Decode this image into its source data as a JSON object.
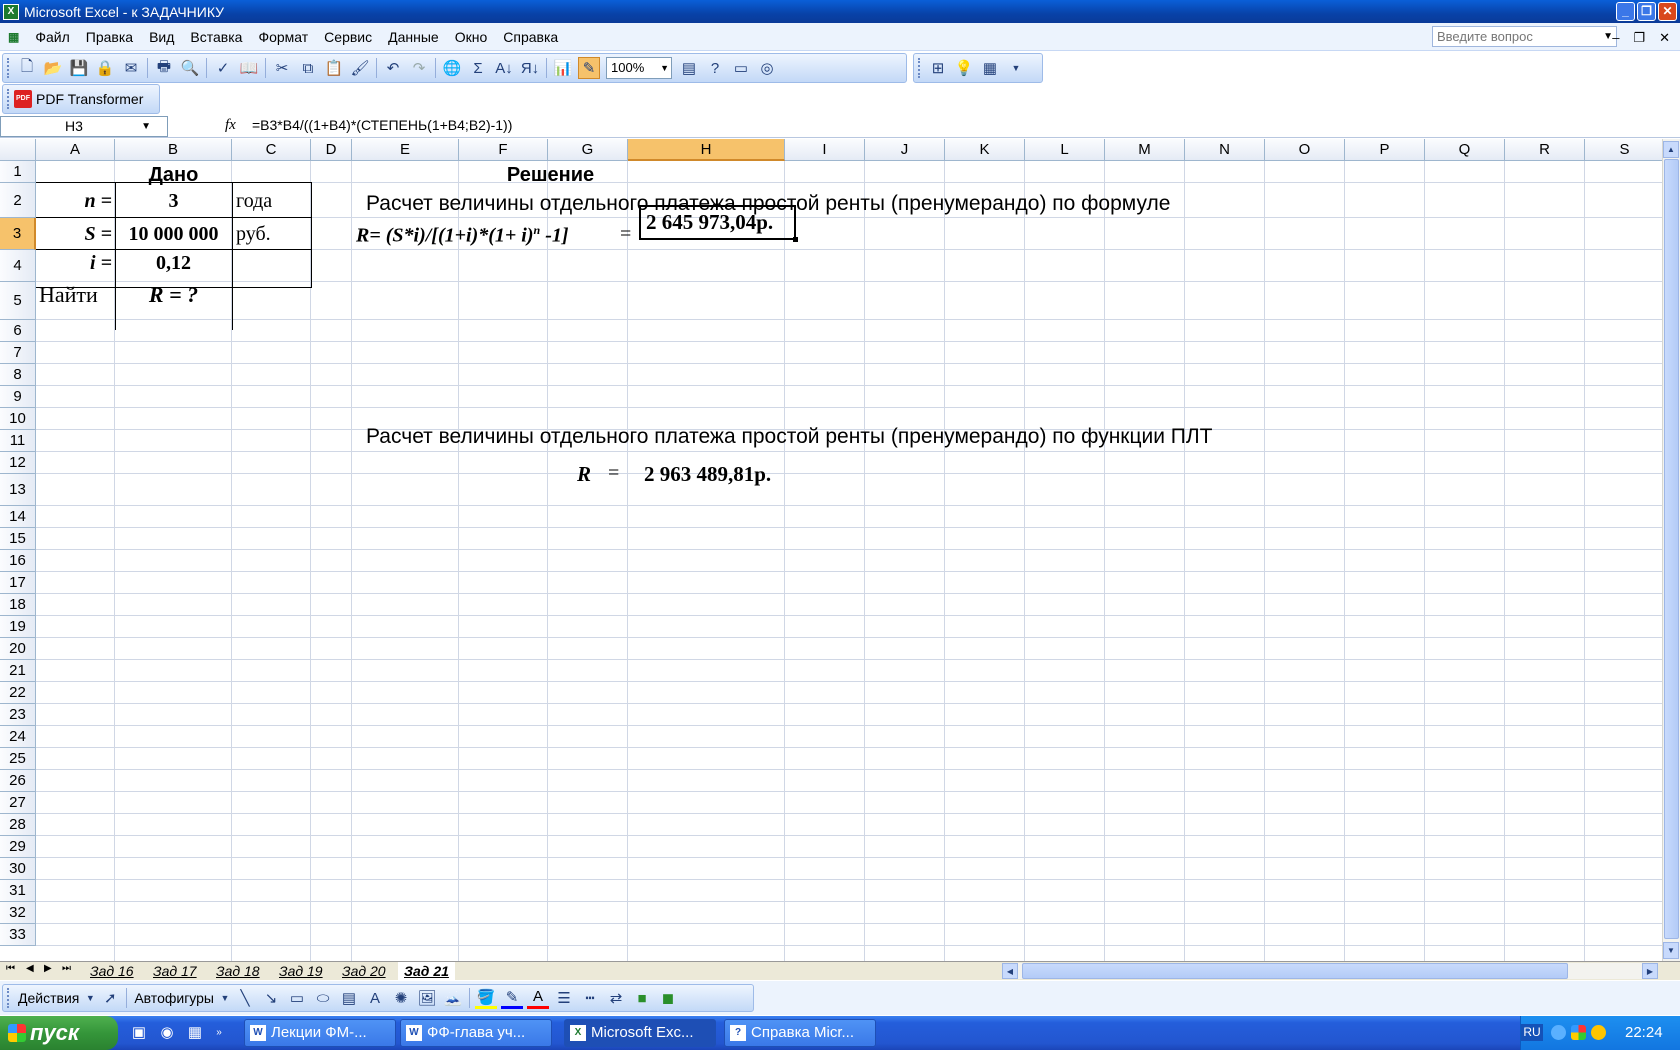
{
  "window": {
    "title": "Microsoft Excel - к ЗАДАЧНИКУ"
  },
  "menu": [
    "Файл",
    "Правка",
    "Вид",
    "Вставка",
    "Формат",
    "Сервис",
    "Данные",
    "Окно",
    "Справка"
  ],
  "help_box": {
    "placeholder": "Введите вопрос"
  },
  "toolbar": {
    "zoom": "100%"
  },
  "pdf_toolbar": {
    "label": "PDF Transformer"
  },
  "formula_bar": {
    "name_box": "H3",
    "fx": "fx",
    "formula": "=B3*B4/((1+B4)*(СТЕПЕНЬ(1+B4;B2)-1))"
  },
  "columns": [
    "A",
    "B",
    "C",
    "D",
    "E",
    "F",
    "G",
    "H",
    "I",
    "J",
    "K",
    "L",
    "M",
    "N",
    "O",
    "P",
    "Q",
    "R",
    "S"
  ],
  "rows": [
    "1",
    "2",
    "3",
    "4",
    "5",
    "6",
    "7",
    "8",
    "9",
    "10",
    "11",
    "12",
    "13",
    "14",
    "15",
    "16",
    "17",
    "18",
    "19",
    "20",
    "21",
    "22",
    "23",
    "24",
    "25",
    "26",
    "27",
    "28",
    "29",
    "30",
    "31",
    "32",
    "33"
  ],
  "selected": {
    "column": "H",
    "row": "3"
  },
  "cells": {
    "B1": "Дано",
    "F1": "Решение",
    "A2": "n =",
    "B2": "3",
    "C2": "года",
    "E2": "Расчет величины отдельного платежа простой ренты (пренумерандо) по формуле",
    "A3": "S =",
    "B3": "10 000 000",
    "C3": "руб.",
    "E3_formula_main": "R= (S*i)/[(1+i)*(1+ i)",
    "E3_formula_sup": "n",
    "E3_formula_tail": " -1]",
    "G3": "=",
    "H3": "2 645 973,04р.",
    "A4": "i =",
    "B4": "0,12",
    "A5": "Найти",
    "B5": "R = ?",
    "E11": "Расчет величины отдельного платежа простой ренты (пренумерандо) по функции ПЛТ",
    "G13_label": "R",
    "G13_eq": "=",
    "H13": "2 963 489,81р."
  },
  "sheet_tabs": [
    "Зад 16",
    "Зад 17",
    "Зад 18",
    "Зад 19",
    "Зад 20",
    "Зад 21"
  ],
  "active_sheet": "Зад 21",
  "draw_toolbar": {
    "actions": "Действия",
    "autoshapes": "Автофигуры"
  },
  "taskbar": {
    "start": "пуск",
    "tasks": [
      "Лекции ФМ-...",
      "ФФ-глава уч...",
      "Microsoft Exc...",
      "Справка Micr..."
    ],
    "active_task": "Microsoft Exc...",
    "lang": "RU",
    "clock": "22:24"
  },
  "colors": {
    "selection_header": "#f6c26b",
    "title_bar": "#0842a8",
    "taskbar": "#245edb",
    "start": "#35963a"
  }
}
